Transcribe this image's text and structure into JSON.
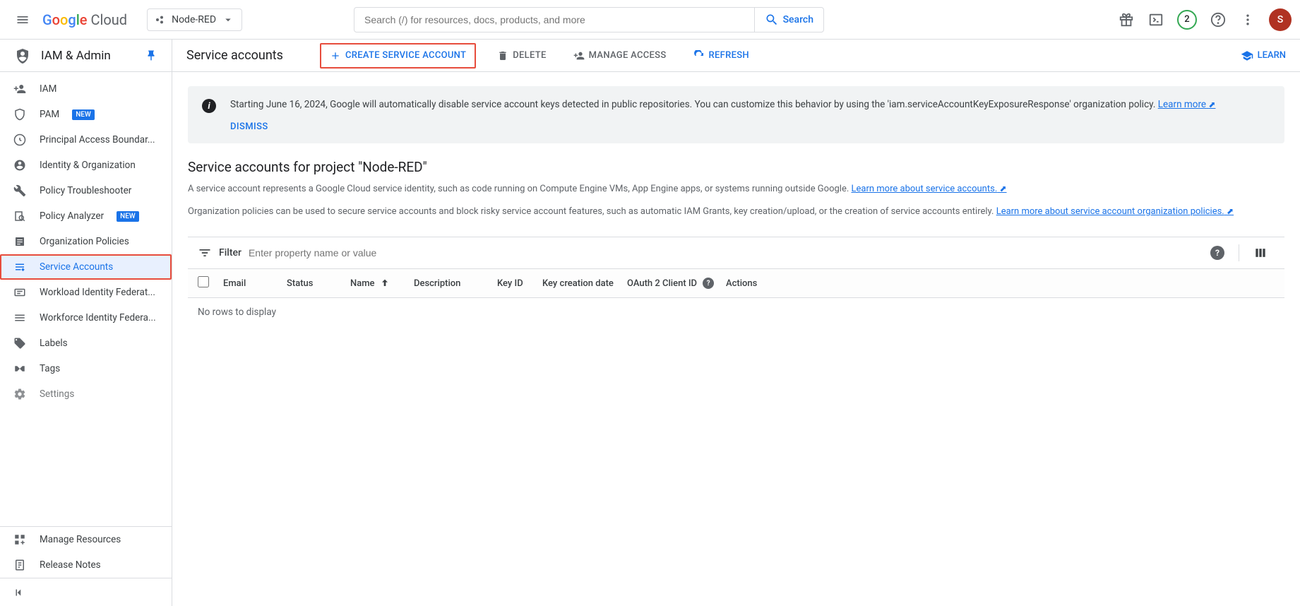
{
  "header": {
    "logo_text": "Cloud",
    "project_name": "Node-RED",
    "search_placeholder": "Search (/) for resources, docs, products, and more",
    "search_button": "Search",
    "notif_count": "2",
    "avatar_initial": "S"
  },
  "sidebar": {
    "section_title": "IAM & Admin",
    "items": [
      {
        "label": "IAM"
      },
      {
        "label": "PAM",
        "badge": "NEW"
      },
      {
        "label": "Principal Access Boundar..."
      },
      {
        "label": "Identity & Organization"
      },
      {
        "label": "Policy Troubleshooter"
      },
      {
        "label": "Policy Analyzer",
        "badge": "NEW"
      },
      {
        "label": "Organization Policies"
      },
      {
        "label": "Service Accounts"
      },
      {
        "label": "Workload Identity Federat..."
      },
      {
        "label": "Workforce Identity Federa..."
      },
      {
        "label": "Labels"
      },
      {
        "label": "Tags"
      },
      {
        "label": "Settings"
      }
    ],
    "bottom_items": [
      {
        "label": "Manage Resources"
      },
      {
        "label": "Release Notes"
      }
    ]
  },
  "actionbar": {
    "page_title": "Service accounts",
    "create": "CREATE SERVICE ACCOUNT",
    "delete": "DELETE",
    "manage": "MANAGE ACCESS",
    "refresh": "REFRESH",
    "learn": "LEARN"
  },
  "banner": {
    "text": "Starting June 16, 2024, Google will automatically disable service account keys detected in public repositories. You can customize this behavior by using the 'iam.serviceAccountKeyExposureResponse' organization policy. ",
    "learn_more": "Learn more",
    "dismiss": "DISMISS"
  },
  "section": {
    "title": "Service accounts for project \"Node-RED\"",
    "desc1": "A service account represents a Google Cloud service identity, such as code running on Compute Engine VMs, App Engine apps, or systems running outside Google. ",
    "link1": "Learn more about service accounts.",
    "desc2": "Organization policies can be used to secure service accounts and block risky service account features, such as automatic IAM Grants, key creation/upload, or the creation of service accounts entirely. ",
    "link2": "Learn more about service account organization policies."
  },
  "filter": {
    "label": "Filter",
    "placeholder": "Enter property name or value"
  },
  "columns": {
    "email": "Email",
    "status": "Status",
    "name": "Name",
    "description": "Description",
    "keyid": "Key ID",
    "keydate": "Key creation date",
    "oauth": "OAuth 2 Client ID",
    "actions": "Actions"
  },
  "table": {
    "empty": "No rows to display"
  }
}
